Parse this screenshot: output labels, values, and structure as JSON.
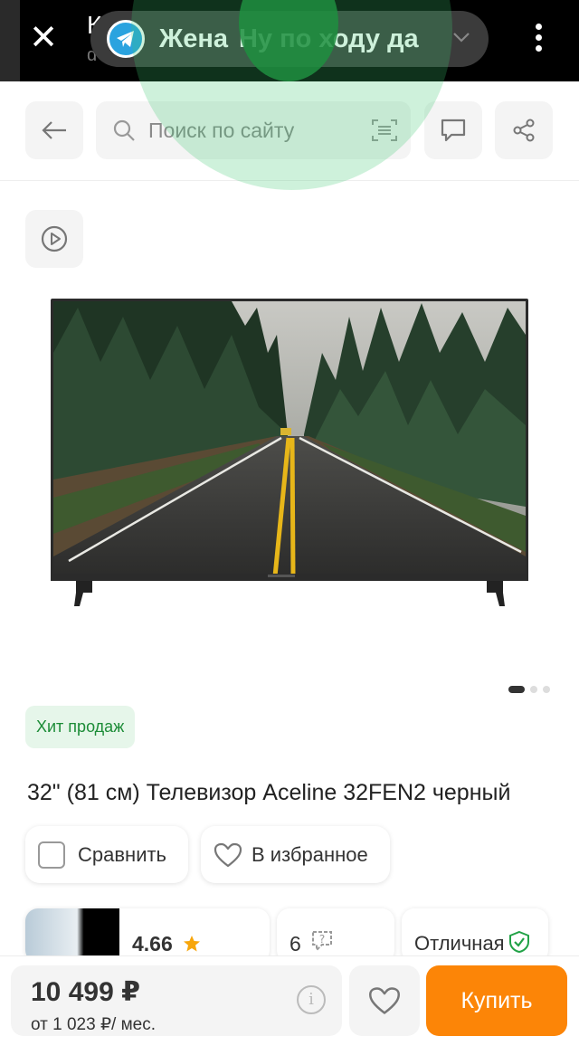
{
  "notification": {
    "app_icon": "telegram-icon",
    "sender": "Жена",
    "message": "Ну по ходу да"
  },
  "underlying_bar": {
    "title_fragment": "К",
    "subtitle_fragment": "d"
  },
  "header": {
    "search_placeholder": "Поиск по сайту"
  },
  "product": {
    "badge": "Хит продаж",
    "title": "32\" (81 см) Телевизор Aceline 32FEN2 черный",
    "compare_label": "Сравнить",
    "favorite_label": "В избранное",
    "rating": "4.66",
    "questions_count": "6",
    "quality_label": "Отличная",
    "gallery_active_index": 1,
    "gallery_total": 3
  },
  "bottom_bar": {
    "price": "10 499 ₽",
    "monthly": "от 1 023 ₽/ мес.",
    "buy_label": "Купить"
  },
  "colors": {
    "accent_orange": "#fc8507",
    "badge_green": "#1c8c37",
    "telegram_blue": "#2aa3df"
  }
}
